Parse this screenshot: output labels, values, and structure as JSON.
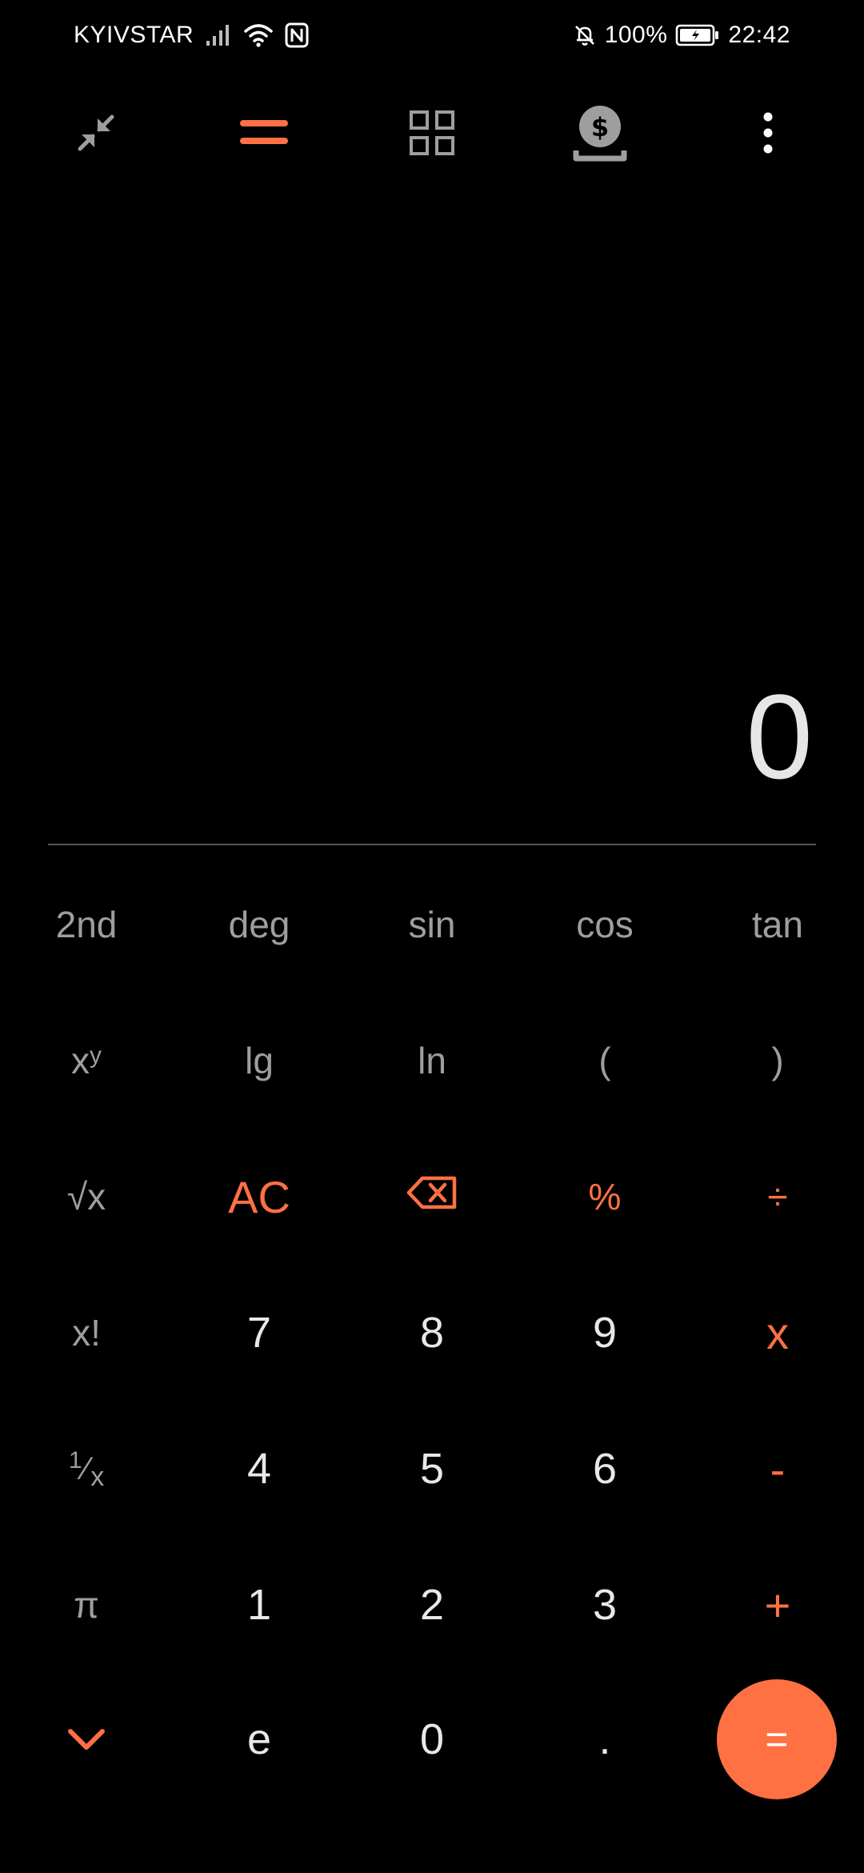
{
  "status_bar": {
    "carrier": "KYIVSTAR",
    "battery": "100%",
    "time": "22:42"
  },
  "toolbar": {
    "icons": [
      "collapse-icon",
      "standard-calculator-icon",
      "grid-icon",
      "currency-converter-icon",
      "more-options-icon"
    ]
  },
  "display": {
    "result": "0"
  },
  "keys": {
    "second": "2nd",
    "deg": "deg",
    "sin": "sin",
    "cos": "cos",
    "tan": "tan",
    "power_base": "x",
    "power_exp": "y",
    "lg": "lg",
    "ln": "ln",
    "paren_open": "(",
    "paren_close": ")",
    "sqrt": "√x",
    "ac": "AC",
    "percent": "%",
    "divide": "÷",
    "factorial": "x!",
    "seven": "7",
    "eight": "8",
    "nine": "9",
    "multiply": "x",
    "reciprocal_num": "1",
    "reciprocal_den": "x",
    "four": "4",
    "five": "5",
    "six": "6",
    "minus": "-",
    "pi": "π",
    "one": "1",
    "two": "2",
    "three": "3",
    "plus": "+",
    "e": "e",
    "zero": "0",
    "dot": ".",
    "equals": "="
  },
  "colors": {
    "accent": "#ff7043",
    "background": "#000000",
    "function_text": "#9e9e9e",
    "number_text": "#e8e8e8"
  }
}
